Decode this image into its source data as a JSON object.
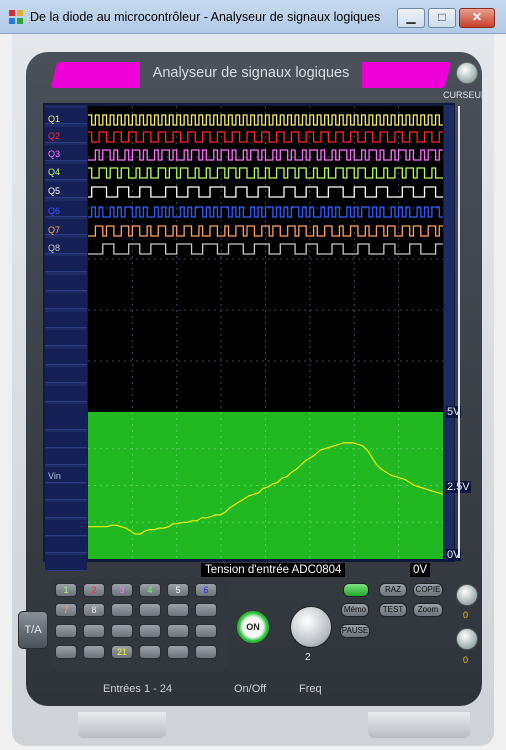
{
  "window": {
    "title": "De la diode au microcontrôleur - Analyseur de signaux logiques",
    "icon": "app-window-icon",
    "minimize_label": "▁",
    "maximize_label": "□",
    "close_label": "✕"
  },
  "header": {
    "title": "Analyseur de signaux logiques",
    "cursor_label": "CURSEUR"
  },
  "channels": [
    {
      "label": "Q1",
      "color": "#f4f36a"
    },
    {
      "label": "Q2",
      "color": "#ff2a2a"
    },
    {
      "label": "Q3",
      "color": "#ff6fff"
    },
    {
      "label": "Q4",
      "color": "#b7ff63"
    },
    {
      "label": "Q5",
      "color": "#ffffff"
    },
    {
      "label": "Q6",
      "color": "#2f5dff"
    },
    {
      "label": "Q7",
      "color": "#ffa25c"
    },
    {
      "label": "Q8",
      "color": "#c8c8c8"
    }
  ],
  "analog": {
    "label": "Vin",
    "voltage_top": "5V",
    "voltage_mid": "2.5V",
    "voltage_bottom": "0V",
    "caption": "Tension d'entrée ADC0804",
    "zero_label": "0V",
    "background": "#22b822",
    "trace_color": "#f2f200",
    "samples_v": [
      1.1,
      1.1,
      1.1,
      1.1,
      1.1,
      1.15,
      1.15,
      1.1,
      1.05,
      0.95,
      0.85,
      0.85,
      0.95,
      1.0,
      1.0,
      1.05,
      1.05,
      1.1,
      1.2,
      1.2,
      1.25,
      1.25,
      1.3,
      1.3,
      1.4,
      1.4,
      1.45,
      1.5,
      1.5,
      1.6,
      1.75,
      1.85,
      1.95,
      2.05,
      2.15,
      2.2,
      2.25,
      2.4,
      2.45,
      2.55,
      2.6,
      2.75,
      2.8,
      2.95,
      3.05,
      3.2,
      3.35,
      3.45,
      3.55,
      3.7,
      3.75,
      3.8,
      3.85,
      3.9,
      3.95,
      3.95,
      3.95,
      3.9,
      3.85,
      3.7,
      3.45,
      3.2,
      3.05,
      2.95,
      2.85,
      2.8,
      2.75,
      2.7,
      2.6,
      2.5,
      2.45,
      2.4,
      2.35,
      2.3,
      2.25,
      2.2
    ]
  },
  "controls": {
    "ta_label": "T/A",
    "input_buttons": [
      {
        "label": "1",
        "color": "#9bff6a"
      },
      {
        "label": "2",
        "color": "#ff3030"
      },
      {
        "label": "3",
        "color": "#ff6cff"
      },
      {
        "label": "4",
        "color": "#6cff6c"
      },
      {
        "label": "5",
        "color": "#ffffff"
      },
      {
        "label": "6",
        "color": "#1d2bff"
      },
      {
        "label": "7",
        "color": "#ff9a5a"
      },
      {
        "label": "8",
        "color": "#e0e0e0"
      },
      {
        "label": "21",
        "color": "#f5f533"
      }
    ],
    "on_label": "ON",
    "freq_value": "2",
    "raz_label": "RAZ",
    "copie_label": "COPIE",
    "memo_label": "Mémo",
    "test_label": "TEST",
    "zoom_label": "Zoom",
    "pause_label": "PAUSE",
    "knob_value_1": "0",
    "knob_value_2": "0",
    "inputs_caption": "Entrées 1 - 24",
    "onoff_caption": "On/Off",
    "freq_caption": "Freq"
  }
}
